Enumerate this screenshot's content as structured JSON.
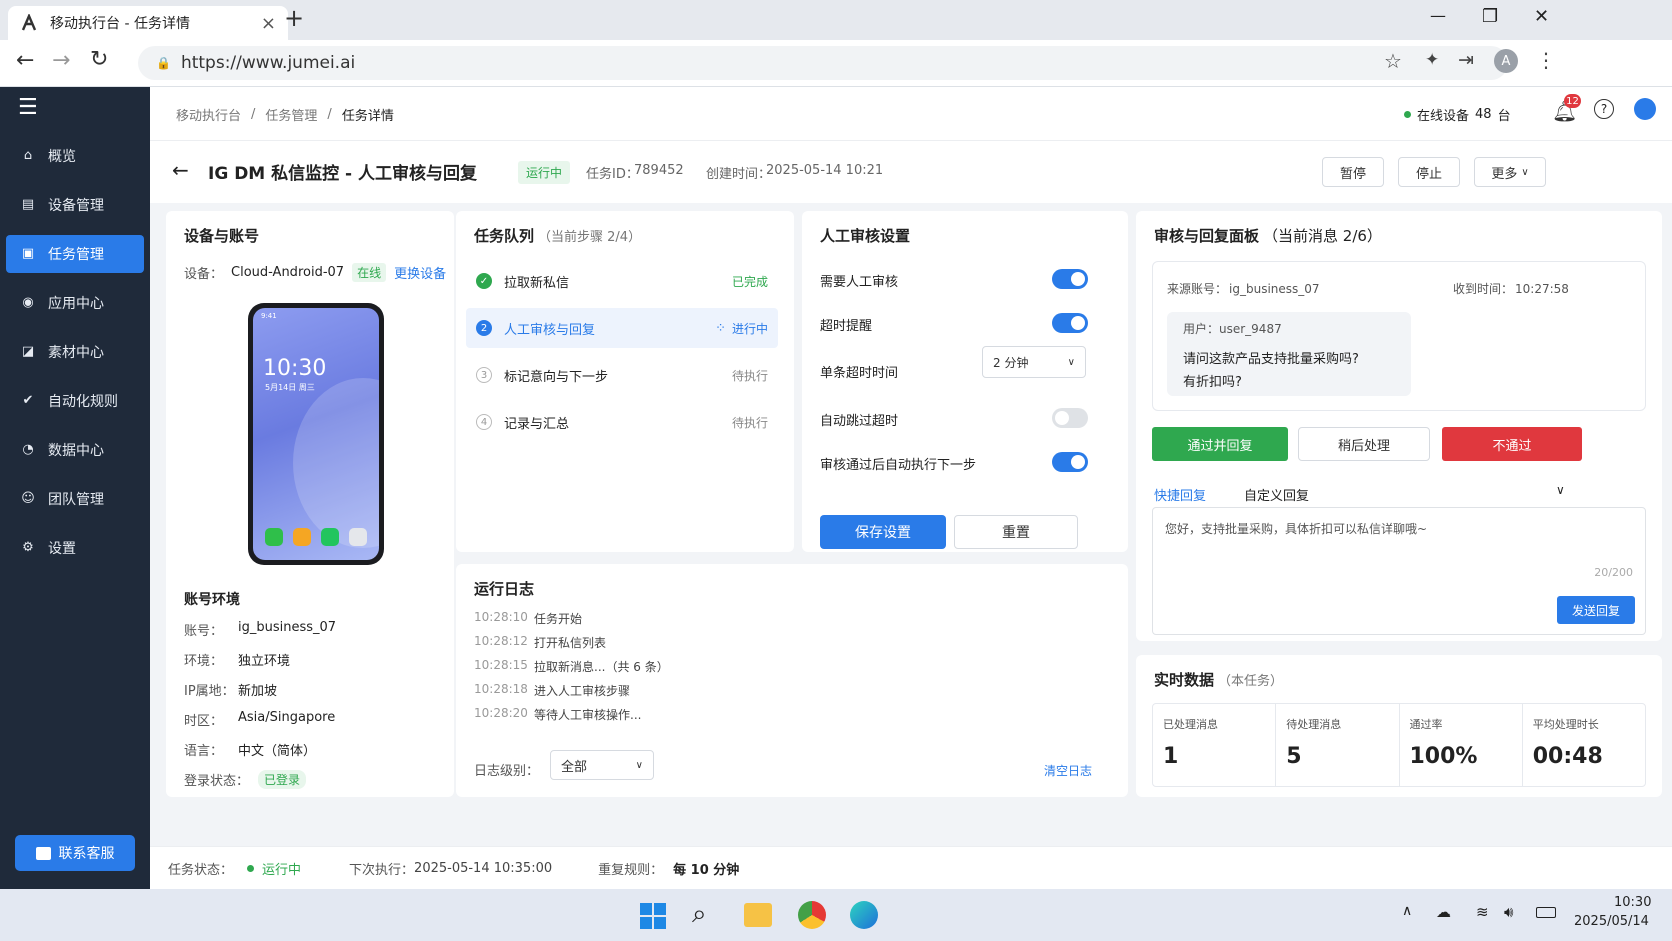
{
  "browser": {
    "tab_title": "移动执行台 - 任务详情",
    "url": "https://www.jumei.ai",
    "new_tab": "+",
    "close_tab": "×",
    "minimize": "—",
    "maximize": "❐",
    "close": "✕",
    "profile_initial": "A"
  },
  "sidebar": {
    "items": [
      {
        "label": "概览",
        "icon": "home-icon"
      },
      {
        "label": "设备管理",
        "icon": "devices-icon"
      },
      {
        "label": "任务管理",
        "icon": "task-icon"
      },
      {
        "label": "应用中心",
        "icon": "apps-icon"
      },
      {
        "label": "素材中心",
        "icon": "material-icon"
      },
      {
        "label": "自动化规则",
        "icon": "rule-icon"
      },
      {
        "label": "数据中心",
        "icon": "chart-icon"
      },
      {
        "label": "团队管理",
        "icon": "team-icon"
      },
      {
        "label": "设置",
        "icon": "gear-icon"
      }
    ],
    "active": "任务管理",
    "contact": "联系客服"
  },
  "breadcrumb": [
    "移动执行台",
    "任务管理",
    "任务详情"
  ],
  "header": {
    "online_label": "在线设备",
    "online_count": "48",
    "online_unit": "台",
    "notif_count": "12"
  },
  "task": {
    "title": "IG DM 私信监控 - 人工审核与回复",
    "status": "运行中",
    "id_label": "任务ID：",
    "id": "789452",
    "created_label": "创建时间：",
    "created": "2025-05-14 10:21",
    "pause": "暂停",
    "stop": "停止",
    "more": "更多"
  },
  "device_card": {
    "title": "设备与账号",
    "device_label": "设备：",
    "device": "Cloud-Android-07",
    "online": "在线",
    "change": "更换设备",
    "phone_time": "10:30",
    "phone_date": "5月14日 周三",
    "phone_carrier": "9:41",
    "env_title": "账号环境",
    "rows": [
      {
        "k": "账号：",
        "v": "ig_business_07"
      },
      {
        "k": "环境：",
        "v": "独立环境"
      },
      {
        "k": "IP属地：",
        "v": "新加坡"
      },
      {
        "k": "时区：",
        "v": "Asia/Singapore"
      },
      {
        "k": "语言：",
        "v": "中文（简体）"
      },
      {
        "k": "登录状态：",
        "v": "已登录"
      }
    ]
  },
  "queue": {
    "title": "任务队列",
    "sub": "（当前步骤 2/4）",
    "steps": [
      {
        "num": "✓",
        "label": "拉取新私信",
        "state": "已完成"
      },
      {
        "num": "2",
        "label": "人工审核与回复",
        "state": "进行中"
      },
      {
        "num": "3",
        "label": "标记意向与下一步",
        "state": "待执行"
      },
      {
        "num": "4",
        "label": "记录与汇总",
        "state": "待执行"
      }
    ]
  },
  "review_settings": {
    "title": "人工审核设置",
    "rows": [
      {
        "label": "需要人工审核",
        "on": true
      },
      {
        "label": "超时提醒",
        "on": true
      },
      {
        "label": "单条超时时间",
        "select": "2 分钟"
      },
      {
        "label": "自动跳过超时",
        "on": false
      },
      {
        "label": "审核通过后自动执行下一步",
        "on": true
      }
    ],
    "save": "保存设置",
    "reset": "重置"
  },
  "log": {
    "title": "运行日志",
    "entries": [
      {
        "t": "10:28:10",
        "m": "任务开始"
      },
      {
        "t": "10:28:12",
        "m": "打开私信列表"
      },
      {
        "t": "10:28:15",
        "m": "拉取新消息...（共 6 条）"
      },
      {
        "t": "10:28:18",
        "m": "进入人工审核步骤"
      },
      {
        "t": "10:28:20",
        "m": "等待人工审核操作..."
      }
    ],
    "level_label": "日志级别：",
    "level": "全部",
    "clear": "清空日志"
  },
  "review_panel": {
    "title": "审核与回复面板",
    "sub": "（当前消息 2/6）",
    "source_label": "来源账号：",
    "source": "ig_business_07",
    "time_label": "收到时间：",
    "time": "10:27:58",
    "user": "用户：user_9487",
    "message_l1": "请问这款产品支持批量采购吗?",
    "message_l2": "有折扣吗?",
    "approve": "通过并回复",
    "later": "稍后处理",
    "reject": "不通过",
    "tab_quick": "快捷回复",
    "tab_custom": "自定义回复",
    "reply": "您好，支持批量采购，具体折扣可以私信详聊哦~",
    "counter": "20/200",
    "send": "发送回复"
  },
  "stats": {
    "title": "实时数据",
    "sub": "（本任务）",
    "items": [
      {
        "label": "已处理消息",
        "value": "1"
      },
      {
        "label": "待处理消息",
        "value": "5"
      },
      {
        "label": "通过率",
        "value": "100%"
      },
      {
        "label": "平均处理时长",
        "value": "00:48"
      }
    ]
  },
  "statusbar": {
    "state_label": "任务状态：",
    "state": "运行中",
    "next_label": "下次执行：",
    "next": "2025-05-14 10:35:00",
    "repeat_label": "重复规则：",
    "repeat": "每 10 分钟"
  },
  "taskbar": {
    "time": "10:30",
    "date": "2025/05/14"
  },
  "colors": {
    "accent": "#2a7be8",
    "success": "#2fa84f",
    "danger": "#e0383e",
    "sidebar": "#1f2a3a"
  }
}
